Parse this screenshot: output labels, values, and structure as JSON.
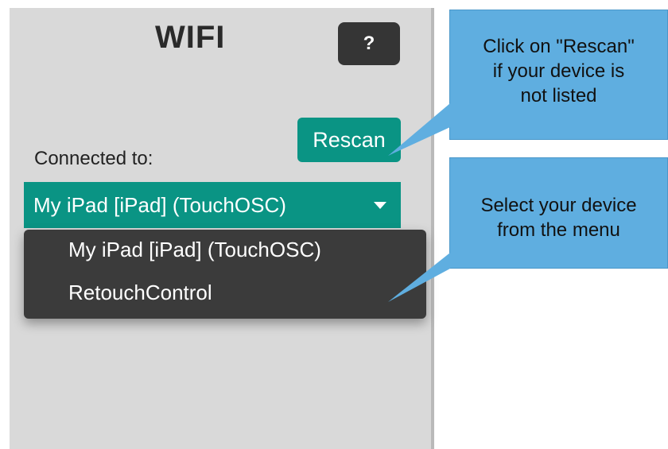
{
  "header": {
    "title": "WIFI",
    "help_label": "?"
  },
  "connection": {
    "label": "Connected to:",
    "rescan_label": "Rescan",
    "selected": "My iPad [iPad] (TouchOSC)",
    "options": [
      "My iPad [iPad] (TouchOSC)",
      "RetouchControl"
    ]
  },
  "callouts": {
    "rescan_tip": [
      "Click on \"Rescan\"",
      "if your device is",
      "not listed"
    ],
    "select_tip": [
      "Select your device",
      "from the menu"
    ]
  },
  "colors": {
    "accent": "#0a9484",
    "panel": "#d9d9d9",
    "callout": "#5faee0",
    "menu": "#3b3b3b"
  }
}
